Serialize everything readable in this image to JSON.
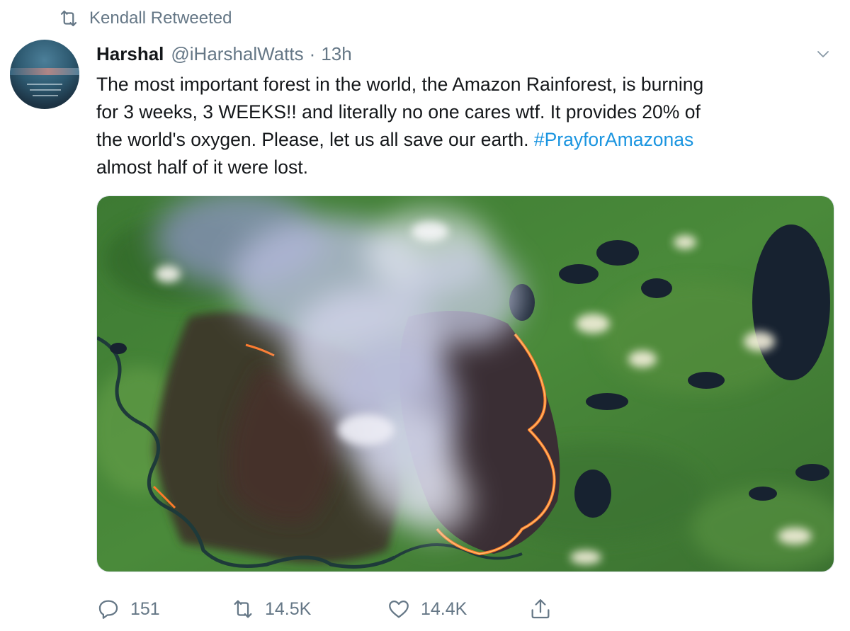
{
  "retweet_context": {
    "text": "Kendall Retweeted",
    "icon": "retweet-icon"
  },
  "tweet": {
    "author_name": "Harshal",
    "author_handle": "@iHarshalWatts",
    "separator": "·",
    "timestamp": "13h",
    "text_lines": [
      "The most important forest in the world, the Amazon Rainforest, is burning",
      "for 3 weeks, 3 WEEKS!! and literally no one cares wtf. It provides 20% of",
      "the world's oxygen. Please, let us all save our earth. ",
      "almost half of it were lost."
    ],
    "hashtag": "#PrayforAmazonas",
    "media_description": "satellite-wildfire-photo"
  },
  "actions": {
    "reply_count": "151",
    "retweet_count": "14.5K",
    "like_count": "14.4K"
  },
  "colors": {
    "link": "#1b95e0",
    "secondary_text": "#657786",
    "primary_text": "#14171a"
  }
}
